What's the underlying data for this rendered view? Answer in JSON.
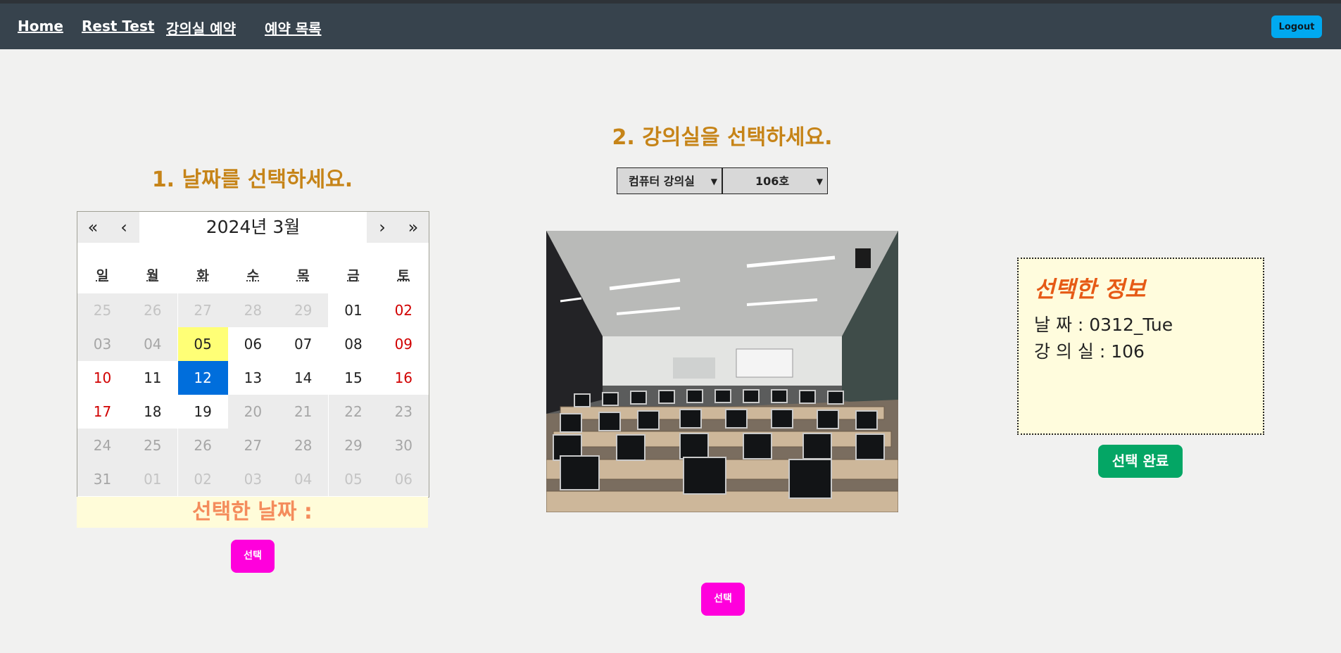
{
  "nav": {
    "items": [
      "Home",
      "Rest Test",
      "강의실 예약",
      "예약 목록"
    ],
    "logout": "Logout"
  },
  "date_section": {
    "heading": "1. 날짜를 선택하세요.",
    "calendar": {
      "title": "2024년 3월",
      "nav_first": "«",
      "nav_prev": "‹",
      "nav_next": "›",
      "nav_last": "»",
      "weekdays": [
        "일",
        "월",
        "화",
        "수",
        "목",
        "금",
        "토"
      ],
      "weeks": [
        [
          "25",
          "26",
          "27",
          "28",
          "29",
          "01",
          "02"
        ],
        [
          "03",
          "04",
          "05",
          "06",
          "07",
          "08",
          "09"
        ],
        [
          "10",
          "11",
          "12",
          "13",
          "14",
          "15",
          "16"
        ],
        [
          "17",
          "18",
          "19",
          "20",
          "21",
          "22",
          "23"
        ],
        [
          "24",
          "25",
          "26",
          "27",
          "28",
          "29",
          "30"
        ],
        [
          "31",
          "01",
          "02",
          "03",
          "04",
          "05",
          "06"
        ]
      ],
      "today": "05",
      "selected": "12"
    },
    "selected_date_label": "선택한 날짜 :",
    "select_button": "선택"
  },
  "room_section": {
    "heading": "2. 강의실을 선택하세요.",
    "room_type": "컴퓨터 강의실",
    "room_number": "106호",
    "select_button": "선택"
  },
  "info": {
    "title": "선택한 정보",
    "date_line": "날 짜 : 0312_Tue",
    "room_line": "강 의 실 : 106",
    "done_button": "선택 완료"
  },
  "colors": {
    "navbar": "#37434d",
    "heading": "#c68418",
    "today_highlight": "#ffff76",
    "selected_highlight": "#006edc",
    "weekend_red": "#d10000",
    "pink_button": "#ff00dc",
    "done_button": "#04a665"
  }
}
